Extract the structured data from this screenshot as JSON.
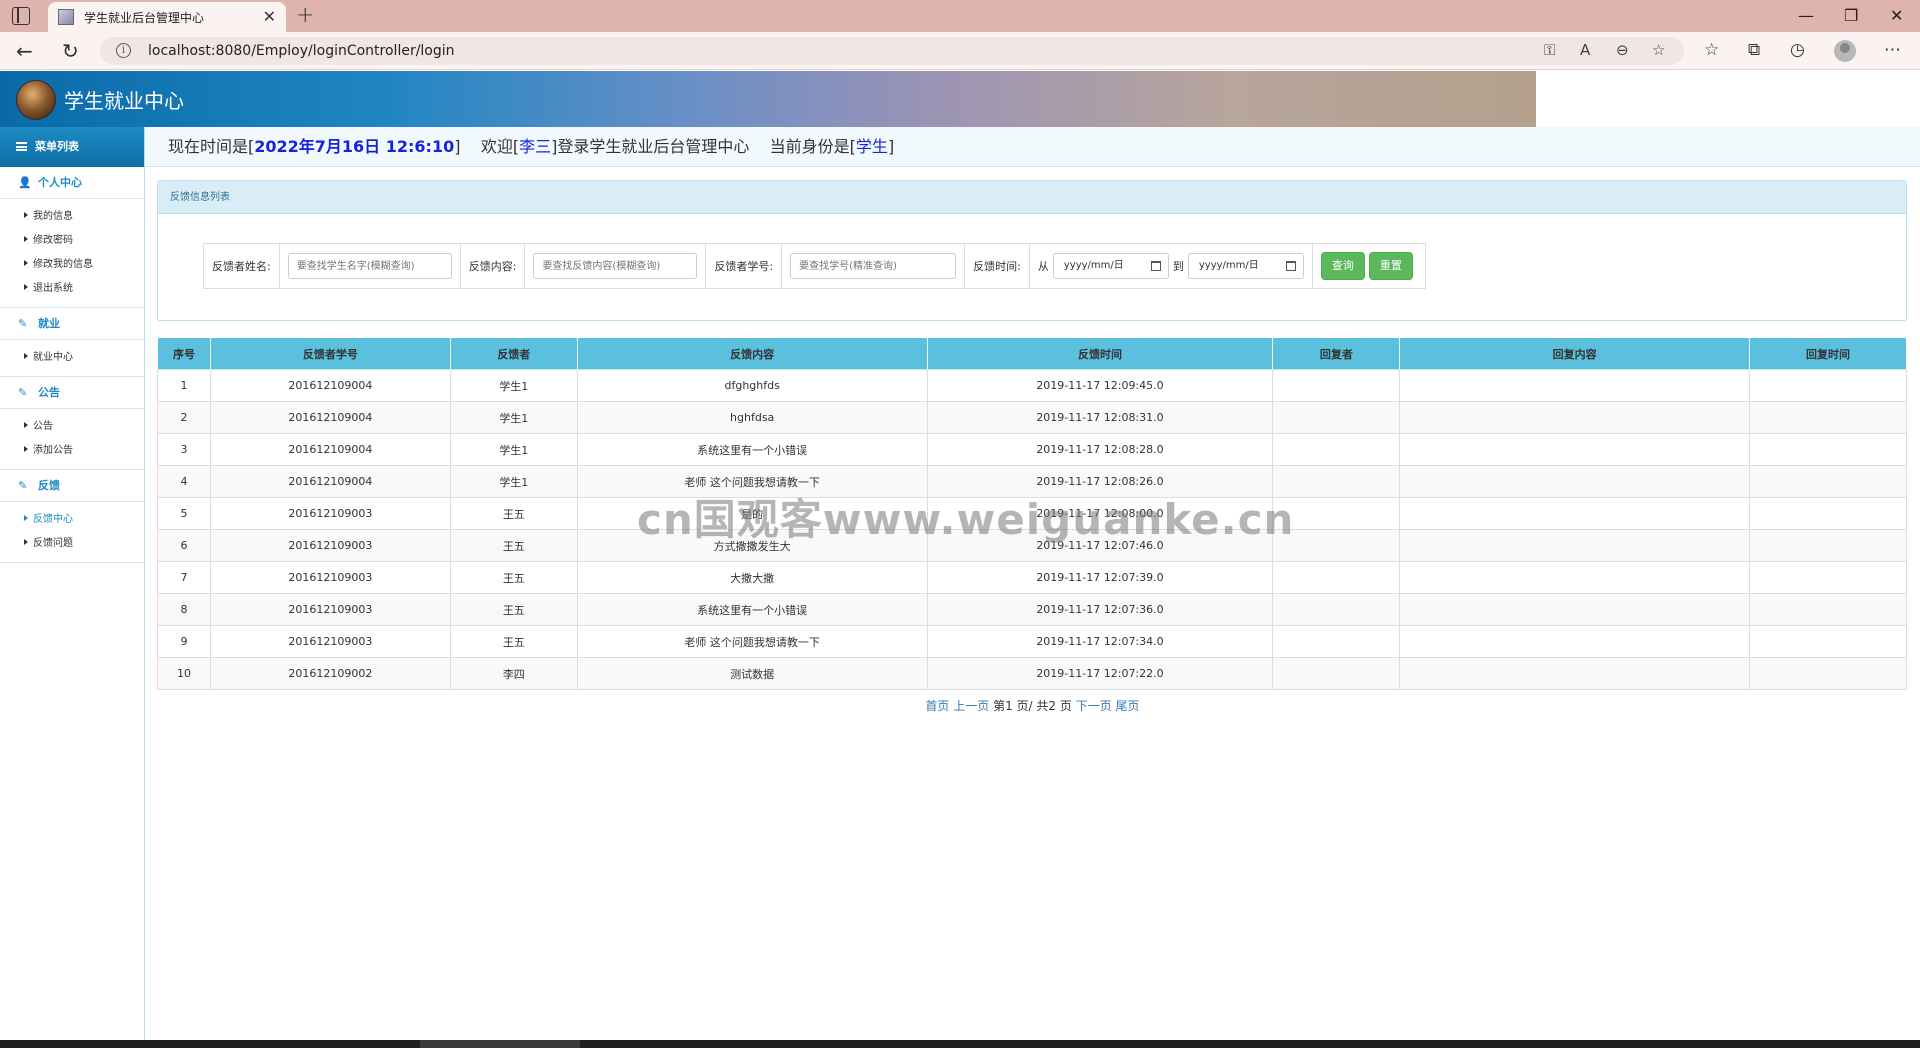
{
  "browser": {
    "tab_title": "学生就业后台管理中心",
    "url": "localhost:8080/Employ/loginController/login"
  },
  "header": {
    "app_title": "学生就业中心"
  },
  "sidebar": {
    "menu_title": "菜单列表",
    "groups": [
      {
        "title": "个人中心",
        "icon": "user-icon",
        "items": [
          "我的信息",
          "修改密码",
          "修改我的信息",
          "退出系统"
        ]
      },
      {
        "title": "就业",
        "icon": "edit-icon",
        "items": [
          "就业中心"
        ]
      },
      {
        "title": "公告",
        "icon": "edit-icon",
        "items": [
          "公告",
          "添加公告"
        ]
      },
      {
        "title": "反馈",
        "icon": "edit-icon",
        "items": [
          "反馈中心",
          "反馈问题"
        ]
      }
    ],
    "active_item": "反馈中心"
  },
  "topbar": {
    "time_prefix": "现在时间是[",
    "time_value": "2022年7月16日 12:6:10",
    "time_suffix": "]",
    "welcome_prefix": "欢迎[",
    "user_name": "李三",
    "welcome_suffix": "]登录学生就业后台管理中心",
    "role_prefix": "当前身份是[",
    "role": "学生",
    "role_suffix": "]"
  },
  "panel": {
    "title": "反馈信息列表",
    "search": {
      "name_label": "反馈者姓名:",
      "name_placeholder": "要查找学生名字(模糊查询)",
      "content_label": "反馈内容:",
      "content_placeholder": "要查找反馈内容(模糊查询)",
      "id_label": "反馈者学号:",
      "id_placeholder": "要查找学号(精准查询)",
      "time_label": "反馈时间:",
      "from_label": "从",
      "to_label": "到",
      "date_placeholder": "yyyy/mm/日",
      "query_button": "查询",
      "reset_button": "重置"
    }
  },
  "table": {
    "columns": [
      "序号",
      "反馈者学号",
      "反馈者",
      "反馈内容",
      "反馈时间",
      "回复者",
      "回复内容",
      "回复时间"
    ],
    "rows": [
      [
        "1",
        "201612109004",
        "学生1",
        "dfghghfds",
        "2019-11-17 12:09:45.0",
        "",
        "",
        ""
      ],
      [
        "2",
        "201612109004",
        "学生1",
        "hghfdsa",
        "2019-11-17 12:08:31.0",
        "",
        "",
        ""
      ],
      [
        "3",
        "201612109004",
        "学生1",
        "系统这里有一个小错误",
        "2019-11-17 12:08:28.0",
        "",
        "",
        ""
      ],
      [
        "4",
        "201612109004",
        "学生1",
        "老师 这个问题我想请教一下",
        "2019-11-17 12:08:26.0",
        "",
        "",
        ""
      ],
      [
        "5",
        "201612109003",
        "王五",
        "是的",
        "2019-11-17 12:08:00.0",
        "",
        "",
        ""
      ],
      [
        "6",
        "201612109003",
        "王五",
        "方式撒撒发生大",
        "2019-11-17 12:07:46.0",
        "",
        "",
        ""
      ],
      [
        "7",
        "201612109003",
        "王五",
        "大撒大撒",
        "2019-11-17 12:07:39.0",
        "",
        "",
        ""
      ],
      [
        "8",
        "201612109003",
        "王五",
        "系统这里有一个小错误",
        "2019-11-17 12:07:36.0",
        "",
        "",
        ""
      ],
      [
        "9",
        "201612109003",
        "王五",
        "老师 这个问题我想请教一下",
        "2019-11-17 12:07:34.0",
        "",
        "",
        ""
      ],
      [
        "10",
        "201612109002",
        "李四",
        "测试数据",
        "2019-11-17 12:07:22.0",
        "",
        "",
        ""
      ]
    ]
  },
  "pager": {
    "first": "首页",
    "prev": "上一页",
    "current": "第1 页/ 共2 页",
    "next": "下一页",
    "last": "尾页"
  },
  "watermark": "cn国观客www.weiguanke.cn"
}
